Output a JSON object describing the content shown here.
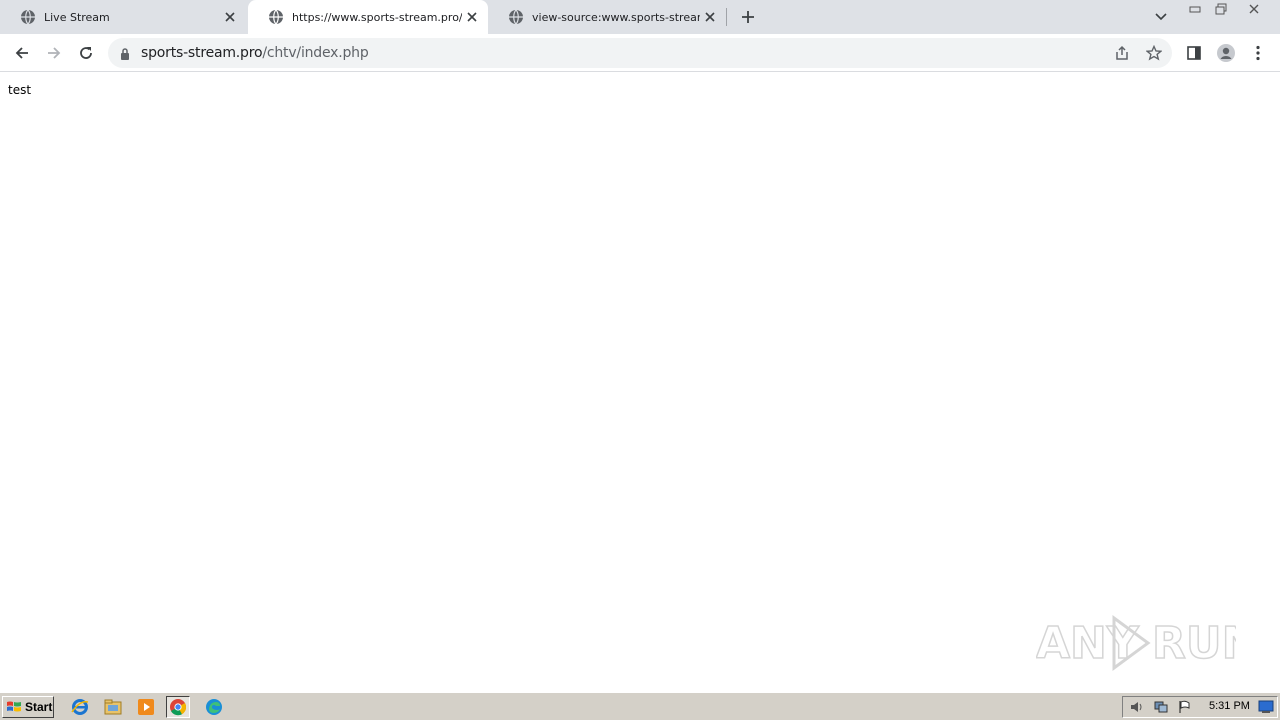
{
  "browser": {
    "tabs": [
      {
        "title": "Live Stream",
        "active": false
      },
      {
        "title": "https://www.sports-stream.pro/chtv",
        "active": true
      },
      {
        "title": "view-source:www.sports-stream.pro",
        "active": false
      }
    ],
    "address": {
      "host": "sports-stream.pro",
      "path": "/chtv/index.php"
    }
  },
  "page": {
    "body_text": "test"
  },
  "watermark": {
    "text": "ANY RUN"
  },
  "taskbar": {
    "start_label": "Start",
    "clock": "5:31 PM"
  },
  "colors": {
    "tabstrip": "#dee1e6",
    "omnibox": "#f1f3f4",
    "taskbar": "#d4d0c8"
  }
}
